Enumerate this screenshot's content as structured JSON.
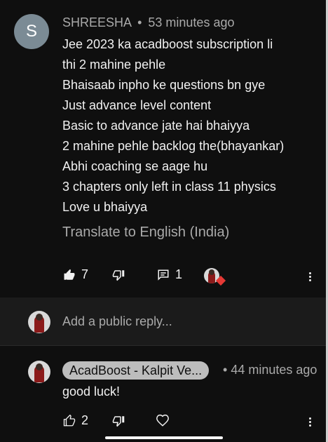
{
  "comment": {
    "avatar_letter": "S",
    "author": "SHREESHA",
    "separator": "•",
    "time": "53 minutes ago",
    "lines": [
      "Jee 2023 ka acadboost subscription li",
      "thi 2 mahine pehle",
      "Bhaisaab inpho ke questions bn gye",
      "Just advance level content",
      "Basic to advance jate hai bhaiyya",
      "2 mahine pehle backlog the(bhayankar)",
      "Abhi coaching se aage hu",
      "3 chapters only left in class 11 physics",
      "Love u bhaiyya"
    ],
    "translate_label": "Translate to English (India)",
    "likes": "7",
    "replies_count": "1"
  },
  "reply_input": {
    "placeholder": "Add a public reply..."
  },
  "reply": {
    "author_chip": "AcadBoost - Kalpit Ve...",
    "separator": "•",
    "time": "44 minutes ago",
    "text": "good luck!",
    "likes": "2"
  },
  "colors": {
    "background": "#0f0f0f",
    "secondary_text": "#aaaaaa",
    "chip": "#bdbdbd",
    "heart": "#e53935"
  }
}
